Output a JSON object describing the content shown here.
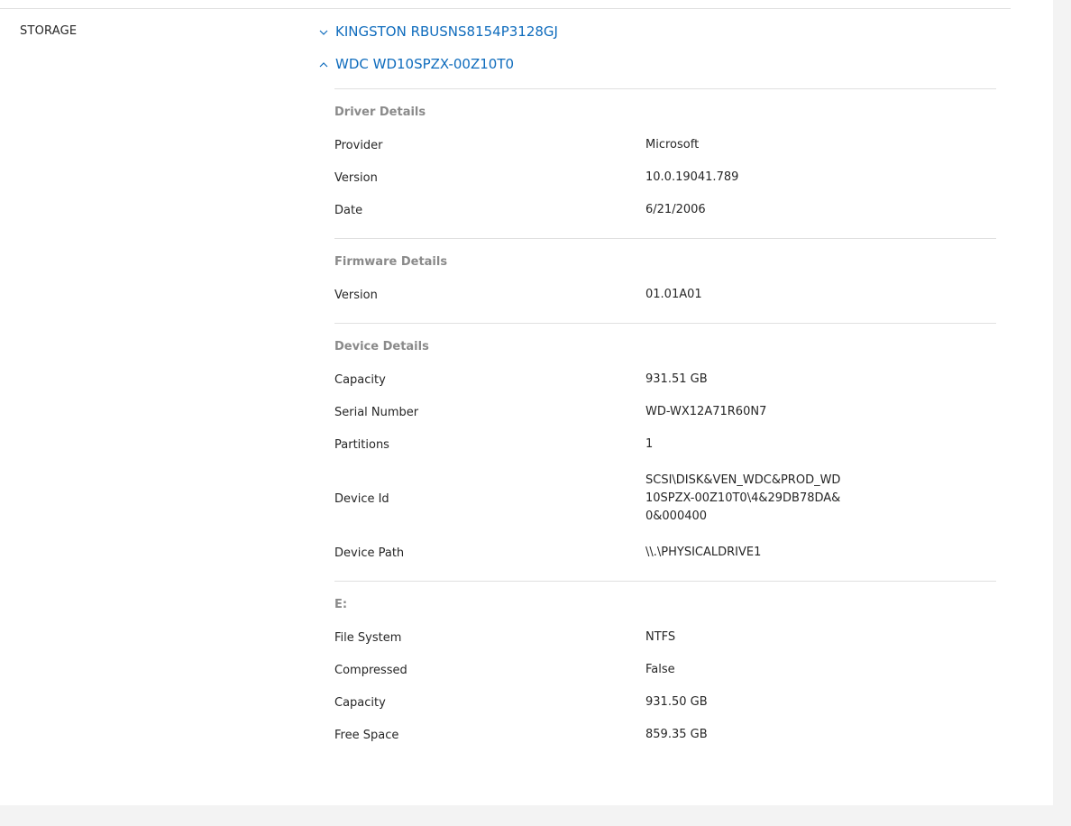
{
  "section": {
    "label": "STORAGE"
  },
  "devices": [
    {
      "name": "KINGSTON RBUSNS8154P3128GJ",
      "expanded": false
    },
    {
      "name": "WDC WD10SPZX-00Z10T0",
      "expanded": true
    }
  ],
  "colors": {
    "link": "#0f6cbd",
    "muted": "#8a8a8a",
    "divider": "#e0e0e0"
  },
  "icons": {
    "collapsed": "chevron-down-icon",
    "expanded": "chevron-up-icon"
  },
  "groups": {
    "driver": {
      "title": "Driver Details",
      "rows": [
        {
          "k": "Provider",
          "v": "Microsoft"
        },
        {
          "k": "Version",
          "v": "10.0.19041.789"
        },
        {
          "k": "Date",
          "v": "6/21/2006"
        }
      ]
    },
    "firmware": {
      "title": "Firmware Details",
      "rows": [
        {
          "k": "Version",
          "v": "01.01A01"
        }
      ]
    },
    "device": {
      "title": "Device Details",
      "rows": [
        {
          "k": "Capacity",
          "v": "931.51 GB"
        },
        {
          "k": "Serial Number",
          "v": "WD-WX12A71R60N7"
        },
        {
          "k": "Partitions",
          "v": "1"
        },
        {
          "k": "Device Id",
          "v": "SCSI\\DISK&VEN_WDC&PROD_WD10SPZX-00Z10T0\\4&29DB78DA&0&000400"
        },
        {
          "k": "Device Path",
          "v": "\\\\.\\PHYSICALDRIVE1"
        }
      ]
    },
    "volume": {
      "title": "E:",
      "rows": [
        {
          "k": "File System",
          "v": "NTFS"
        },
        {
          "k": "Compressed",
          "v": "False"
        },
        {
          "k": "Capacity",
          "v": "931.50 GB"
        },
        {
          "k": "Free Space",
          "v": "859.35 GB"
        }
      ]
    }
  }
}
